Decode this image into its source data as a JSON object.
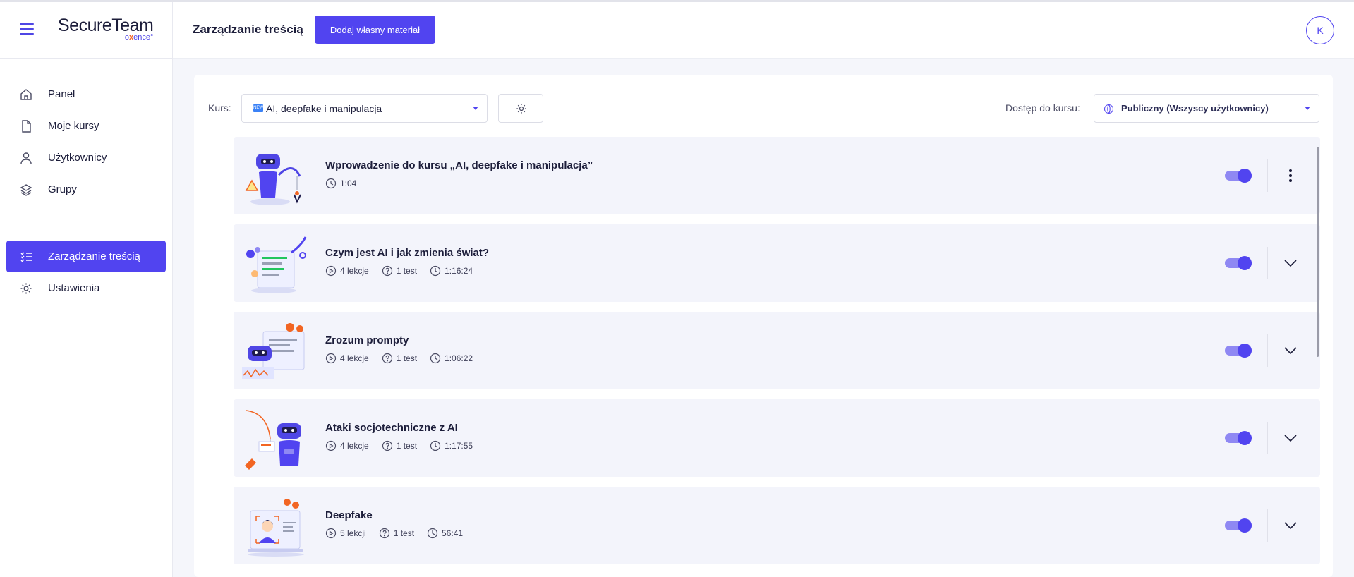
{
  "brand": {
    "name": "SecureTeam",
    "sub_prefix": "o",
    "sub_accent": "x",
    "sub_suffix": "ence",
    "sub_mark": "°"
  },
  "sidebar": {
    "items": [
      {
        "label": "Panel",
        "icon": "home-icon"
      },
      {
        "label": "Moje kursy",
        "icon": "file-icon"
      },
      {
        "label": "Użytkownicy",
        "icon": "user-icon"
      },
      {
        "label": "Grupy",
        "icon": "layers-icon"
      }
    ],
    "admin_items": [
      {
        "label": "Zarządzanie treścią",
        "icon": "list-check-icon",
        "active": true
      },
      {
        "label": "Ustawienia",
        "icon": "gear-icon"
      }
    ]
  },
  "header": {
    "title": "Zarządzanie treścią",
    "add_button": "Dodaj własny materiał",
    "avatar_initial": "K"
  },
  "filters": {
    "course_label": "Kurs:",
    "course_flag": "NEW",
    "course_value": "AI, deepfake i manipulacja",
    "access_label": "Dostęp do kursu:",
    "access_value": "Publiczny (Wszyscy użytkownicy)"
  },
  "modules": [
    {
      "title": "Wprowadzenie do kursu „AI, deepfake i manipulacja”",
      "duration": "1:04",
      "enabled": true,
      "action": "more-vertical-icon"
    },
    {
      "title": "Czym jest AI i jak zmienia świat?",
      "lessons": "4 lekcje",
      "tests": "1 test",
      "duration": "1:16:24",
      "enabled": true,
      "action": "chevron-down-icon"
    },
    {
      "title": "Zrozum prompty",
      "lessons": "4 lekcje",
      "tests": "1 test",
      "duration": "1:06:22",
      "enabled": true,
      "action": "chevron-down-icon"
    },
    {
      "title": "Ataki socjotechniczne z AI",
      "lessons": "4 lekcje",
      "tests": "1 test",
      "duration": "1:17:55",
      "enabled": true,
      "action": "chevron-down-icon"
    },
    {
      "title": "Deepfake",
      "lessons": "5 lekcji",
      "tests": "1 test",
      "duration": "56:41",
      "enabled": true,
      "action": "chevron-down-icon"
    }
  ],
  "colors": {
    "accent": "#5144f0",
    "accent_light": "#8f88f3",
    "orange": "#f26522",
    "row_bg": "#f3f4fb"
  }
}
